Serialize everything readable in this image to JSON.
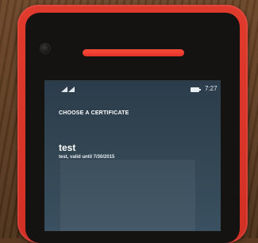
{
  "status_bar": {
    "time": "7:27",
    "signal_icon": "signal-bars-icon",
    "wifi_icon": "wifi-icon",
    "battery_icon": "battery-icon"
  },
  "dialog": {
    "heading": "CHOOSE A CERTIFICATE",
    "certificates": [
      {
        "name": "test",
        "detail": "test, valid until 7/30/2015"
      }
    ]
  },
  "colors": {
    "phone_body": "#d9342a",
    "speaker": "#f13a2e",
    "screen_top": "#2c3c4b",
    "screen_bottom": "#3a5060"
  }
}
